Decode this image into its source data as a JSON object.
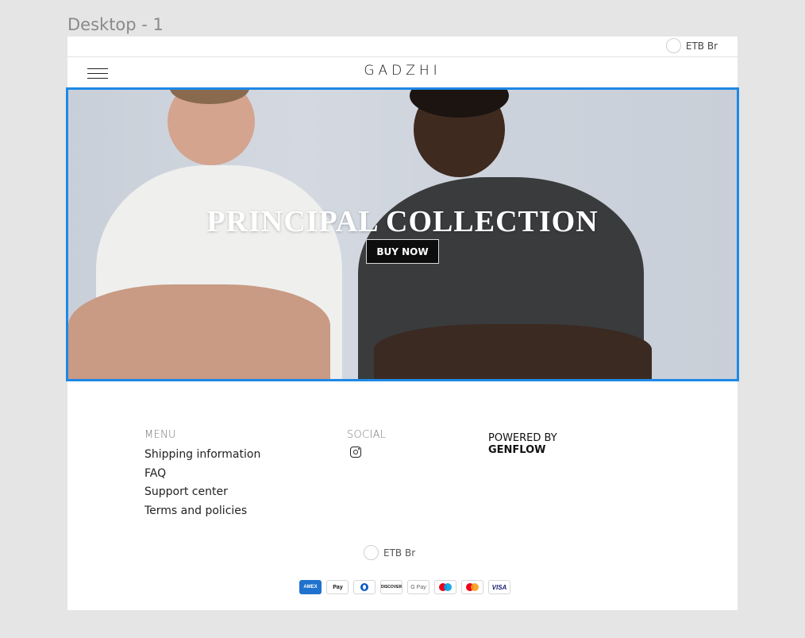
{
  "canvas": {
    "frame_label": "Desktop - 1"
  },
  "topbar": {
    "currency": "ETB Br"
  },
  "navbar": {
    "brand": "GADZHI"
  },
  "hero": {
    "title": "PRINCIPAL COLLECTION",
    "button_label": "BUY NOW",
    "selection_color": "#1e88e5"
  },
  "footer": {
    "menu": {
      "heading": "MENU",
      "items": [
        "Shipping information",
        "FAQ",
        "Support center",
        "Terms and policies"
      ]
    },
    "social": {
      "heading": "SOCIAL",
      "icons": [
        "instagram-icon"
      ]
    },
    "powered": {
      "line1": "POWERED BY",
      "line2": "GENFLOW"
    },
    "currency": "ETB Br",
    "payments": [
      {
        "name": "amex",
        "label": "AMEX"
      },
      {
        "name": "apple-pay",
        "label": "Pay"
      },
      {
        "name": "diners",
        "label": ""
      },
      {
        "name": "discover",
        "label": "DISCOVER"
      },
      {
        "name": "google-pay",
        "label": "G Pay"
      },
      {
        "name": "maestro",
        "label": ""
      },
      {
        "name": "mastercard",
        "label": ""
      },
      {
        "name": "visa",
        "label": "VISA"
      }
    ]
  }
}
